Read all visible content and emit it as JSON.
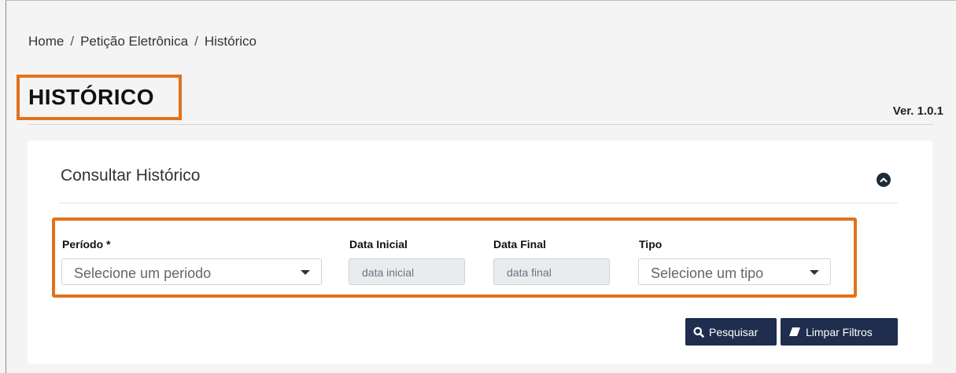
{
  "breadcrumb": {
    "items": [
      "Home",
      "Petição Eletrônica",
      "Histórico"
    ],
    "separator": "/"
  },
  "page": {
    "title": "HISTÓRICO",
    "version": "Ver. 1.0.1"
  },
  "panel": {
    "title": "Consultar Histórico",
    "collapse_icon": "chevron-up-circle-icon"
  },
  "filters": {
    "periodo": {
      "label": "Período *",
      "placeholder": "Selecione um periodo"
    },
    "data_inicial": {
      "label": "Data Inicial",
      "placeholder": "data inicial"
    },
    "data_final": {
      "label": "Data Final",
      "placeholder": "data final"
    },
    "tipo": {
      "label": "Tipo",
      "placeholder": "Selecione um tipo"
    }
  },
  "actions": {
    "search_label": "Pesquisar",
    "search_icon": "search-icon",
    "clear_label": "Limpar Filtros",
    "clear_icon": "eraser-icon"
  },
  "colors": {
    "highlight": "#e2711d",
    "button": "#1f2e4e"
  }
}
